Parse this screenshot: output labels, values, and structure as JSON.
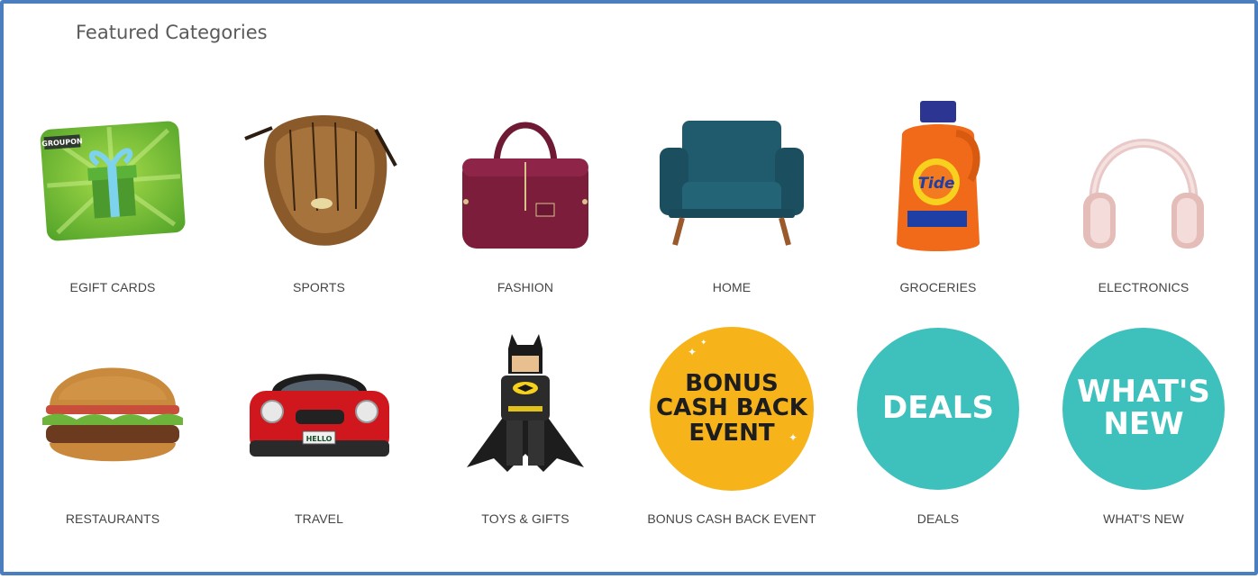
{
  "section": {
    "title": "Featured Categories"
  },
  "colors": {
    "frame": "#4a7ebf",
    "teal": "#3ec0bd",
    "gold": "#f6b31a"
  },
  "categories": [
    {
      "label": "EGIFT CARDS",
      "icon": "groupon-gift-card-icon",
      "badge": "GROUPON"
    },
    {
      "label": "SPORTS",
      "icon": "baseball-glove-icon"
    },
    {
      "label": "FASHION",
      "icon": "handbag-icon"
    },
    {
      "label": "HOME",
      "icon": "armchair-icon"
    },
    {
      "label": "GROCERIES",
      "icon": "detergent-bottle-icon",
      "brand": "Tide"
    },
    {
      "label": "ELECTRONICS",
      "icon": "headphones-icon"
    },
    {
      "label": "RESTAURANTS",
      "icon": "hamburger-icon"
    },
    {
      "label": "TRAVEL",
      "icon": "car-icon",
      "plate": "HELLO"
    },
    {
      "label": "TOYS & GIFTS",
      "icon": "lego-batman-icon"
    },
    {
      "label": "BONUS CASH BACK EVENT",
      "icon": "bonus-badge-icon",
      "badge_text": [
        "BONUS",
        "CASH BACK",
        "EVENT"
      ]
    },
    {
      "label": "DEALS",
      "icon": "deals-badge-icon",
      "badge_text": [
        "DEALS"
      ]
    },
    {
      "label": "WHAT'S NEW",
      "icon": "whats-new-badge-icon",
      "badge_text": [
        "WHAT'S",
        "NEW"
      ]
    }
  ]
}
